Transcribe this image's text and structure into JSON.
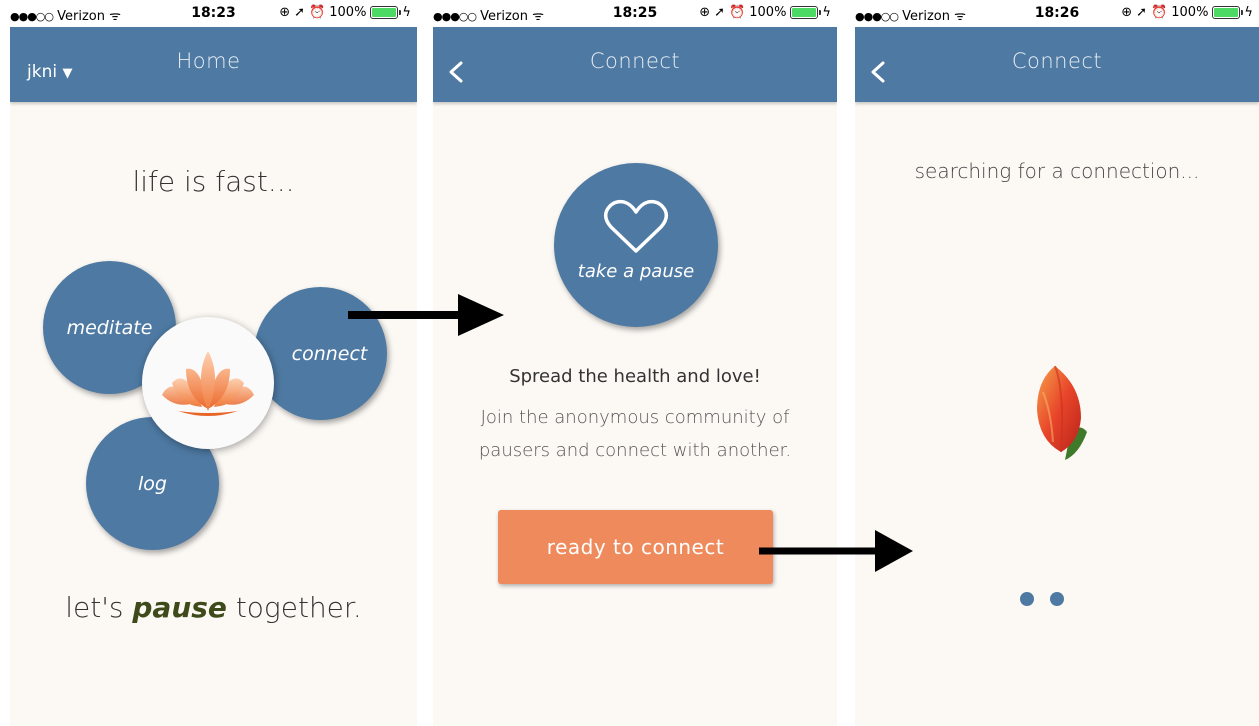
{
  "status": {
    "carrier": "Verizon",
    "times": [
      "18:23",
      "18:25",
      "18:26"
    ],
    "battery": "100%"
  },
  "screen1": {
    "user": "jkni",
    "title": "Home",
    "tagline": "life is fast...",
    "bubbles": {
      "meditate": "meditate",
      "connect": "connect",
      "log": "log"
    },
    "footer_prefix": "let's ",
    "footer_emph": "pause",
    "footer_suffix": " together."
  },
  "screen2": {
    "title": "Connect",
    "pause_label": "take a pause",
    "headline": "Spread the health and love!",
    "body_line1": "Join the anonymous community of",
    "body_line2": "pausers and connect with another.",
    "button": "ready to connect"
  },
  "screen3": {
    "title": "Connect",
    "searching": "searching for a connection..."
  },
  "colors": {
    "nav": "#4e79a2",
    "accent": "#ef8a5c",
    "background": "#fcf9f5"
  },
  "icons": [
    "wifi-icon",
    "lock-rotation-icon",
    "location-icon",
    "alarm-icon",
    "battery-icon",
    "chevron-left-icon",
    "heart-icon",
    "lotus-icon",
    "tulip-icon"
  ]
}
